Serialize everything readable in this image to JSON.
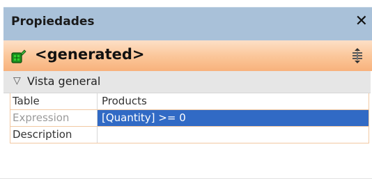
{
  "panel": {
    "title": "Propiedades",
    "close_glyph": "✕"
  },
  "object": {
    "icon": "table-expression-icon",
    "name": "<generated>",
    "sort_icon": "sort-properties-icon"
  },
  "section": {
    "expander_glyph": "▽",
    "label": "Vista general"
  },
  "properties": [
    {
      "name": "Table",
      "value": "Products"
    },
    {
      "name": "Expression",
      "value": "[Quantity] >= 0"
    },
    {
      "name": "Description",
      "value": ""
    }
  ],
  "colors": {
    "titlebar": "#a9c1d9",
    "header_gradient_top": "#fde0c7",
    "header_gradient_bottom": "#f8b27c",
    "selection": "#316ac5",
    "grid_border": "#f2c8a2"
  }
}
